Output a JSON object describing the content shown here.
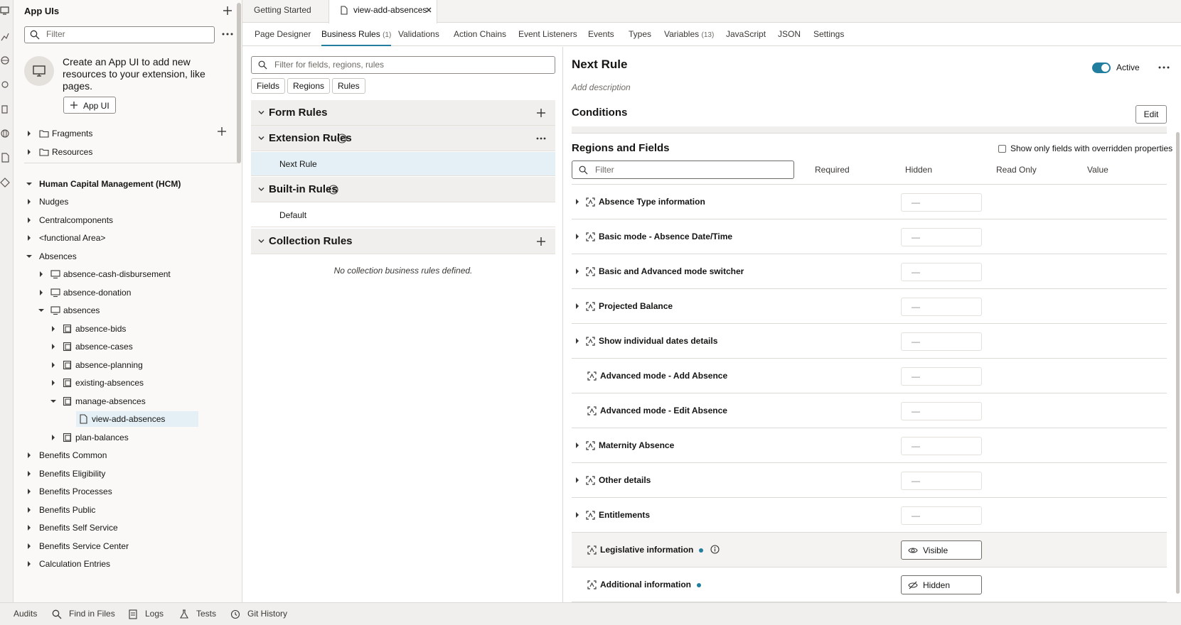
{
  "left_panel": {
    "title": "App UIs",
    "filter_placeholder": "Filter",
    "cta_text": "Create an App UI to add new resources to your extension, like pages.",
    "cta_button": "App UI",
    "tree": {
      "fragments": "Fragments",
      "resources": "Resources",
      "hcm": "Human Capital Management (HCM)",
      "nudges": "Nudges",
      "centralcomponents": "Centralcomponents",
      "functional_area": "<functional Area>",
      "absences": "Absences",
      "absence_cash": "absence-cash-disbursement",
      "absence_donation": "absence-donation",
      "absences_app": "absences",
      "absence_bids": "absence-bids",
      "absence_cases": "absence-cases",
      "absence_planning": "absence-planning",
      "existing_absences": "existing-absences",
      "manage_absences": "manage-absences",
      "view_add_absences": "view-add-absences",
      "plan_balances": "plan-balances",
      "benefits_common": "Benefits Common",
      "benefits_eligibility": "Benefits Eligibility",
      "benefits_processes": "Benefits Processes",
      "benefits_public": "Benefits Public",
      "benefits_self_service": "Benefits Self Service",
      "benefits_service_center": "Benefits Service Center",
      "calculation_entries": "Calculation Entries"
    }
  },
  "tabs": {
    "getting_started": "Getting Started",
    "view_add_absences": "view-add-absences"
  },
  "subnav": {
    "page_designer": "Page Designer",
    "business_rules": "Business Rules",
    "business_rules_count": "(1)",
    "validations": "Validations",
    "action_chains": "Action Chains",
    "event_listeners": "Event Listeners",
    "events": "Events",
    "types": "Types",
    "variables": "Variables",
    "variables_count": "(13)",
    "javascript": "JavaScript",
    "json": "JSON",
    "settings": "Settings"
  },
  "rules_panel": {
    "filter_placeholder": "Filter for fields, regions, rules",
    "chips": {
      "fields": "Fields",
      "regions": "Regions",
      "rules": "Rules"
    },
    "form_rules": "Form Rules",
    "extension_rules": "Extension Rules",
    "next_rule": "Next Rule",
    "builtin_rules": "Built-in Rules",
    "default": "Default",
    "collection_rules": "Collection Rules",
    "no_collection": "No collection business rules defined."
  },
  "detail": {
    "title": "Next Rule",
    "description_placeholder": "Add description",
    "active_label": "Active",
    "active": true,
    "conditions": "Conditions",
    "edit": "Edit",
    "regions_fields": "Regions and Fields",
    "show_only_overridden": "Show only fields with overridden properties",
    "filter_placeholder": "Filter",
    "columns": {
      "required": "Required",
      "hidden": "Hidden",
      "read_only": "Read Only",
      "value": "Value"
    },
    "dash": "—",
    "rows": [
      {
        "label": "Absence Type information"
      },
      {
        "label": "Basic mode - Absence Date/Time"
      },
      {
        "label": "Basic and Advanced mode switcher"
      },
      {
        "label": "Projected Balance"
      },
      {
        "label": "Show individual dates details"
      },
      {
        "label": "Advanced mode - Add Absence"
      },
      {
        "label": "Advanced mode - Edit Absence"
      },
      {
        "label": "Maternity Absence"
      },
      {
        "label": "Other details"
      },
      {
        "label": "Entitlements"
      },
      {
        "label": "Legislative information",
        "state": "Visible"
      },
      {
        "label": "Additional information",
        "state": "Hidden"
      }
    ]
  },
  "bottom_bar": {
    "audits": "Audits",
    "find_in_files": "Find in Files",
    "logs": "Logs",
    "tests": "Tests",
    "git_history": "Git History"
  },
  "colors": {
    "accent": "#227e9e",
    "selected_bg": "#e4f0f6",
    "section_bg": "#f1efed"
  }
}
